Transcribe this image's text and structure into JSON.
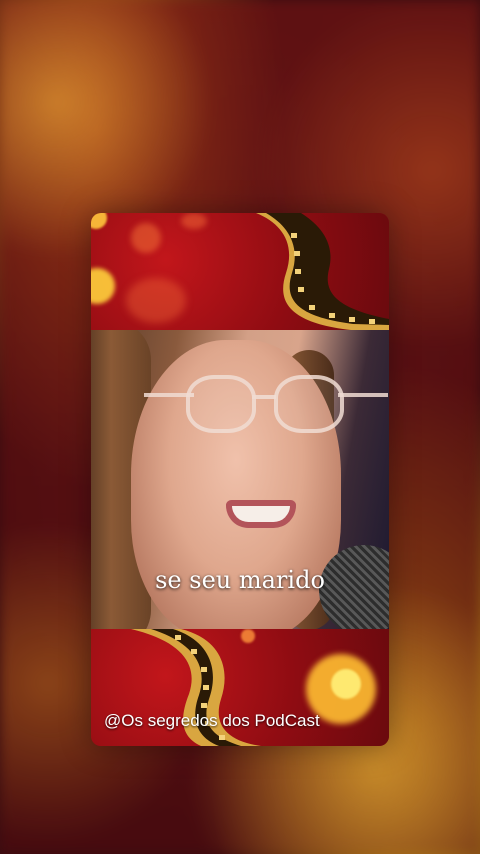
{
  "post": {
    "subtitle": "se seu marido",
    "credit": "@Os segredos dos PodCast"
  },
  "colors": {
    "frame_red": "#8f0c12",
    "film_gold": "#d9a640",
    "subtitle_text": "#ffffff"
  },
  "icons": {
    "film_strip": "film-strip-decoration",
    "microphone": "microphone"
  }
}
